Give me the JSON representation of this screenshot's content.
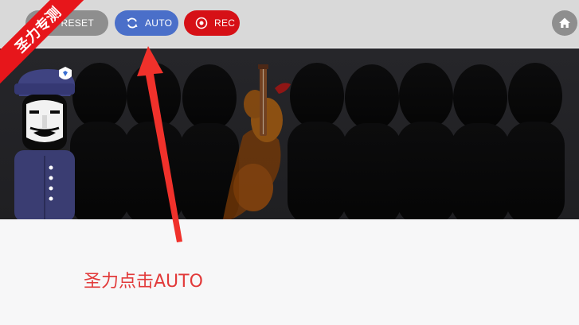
{
  "toolbar": {
    "reset_label": "RESET",
    "auto_label": "AUTO",
    "rec_label": "REC"
  },
  "ribbon": {
    "text": "圣力专测"
  },
  "annotation": {
    "text": "圣力点击AUTO"
  },
  "icons": {
    "auto": "refresh-icon",
    "rec": "record-icon",
    "home": "home-icon"
  },
  "colors": {
    "auto_button": "#4a6fc9",
    "rec_button": "#d61016",
    "reset_button": "#8e8e8e",
    "annotation": "#e23a3a",
    "ribbon": "#e7161b"
  }
}
